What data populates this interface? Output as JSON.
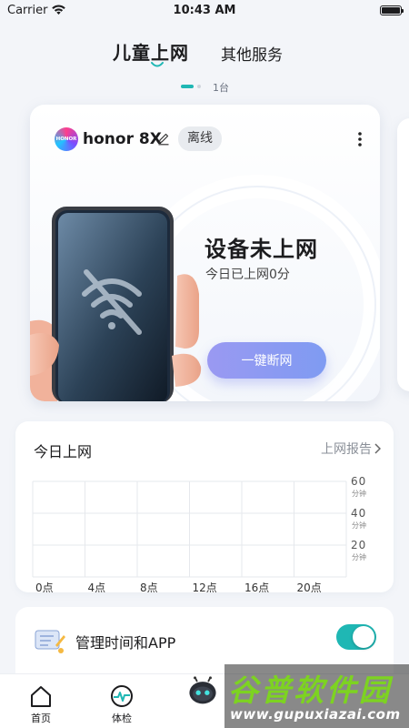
{
  "status_bar": {
    "carrier": "Carrier",
    "time": "10:43 AM"
  },
  "top_tabs": [
    {
      "label": "儿童上网",
      "active": true
    },
    {
      "label": "其他服务",
      "active": false
    }
  ],
  "pager": {
    "device_count": "1台"
  },
  "device_card": {
    "brand_logo_text": "HONOR",
    "device_name": "honor 8X",
    "status": "离线",
    "title": "设备未上网",
    "subtitle": "今日已上网0分",
    "disconnect_button": "一键断网",
    "icons": [
      "edit-icon",
      "more-icon",
      "wifi-off-icon"
    ]
  },
  "usage": {
    "title": "今日上网",
    "report_link": "上网报告",
    "chart_data": {
      "type": "bar",
      "categories": [
        "0点",
        "4点",
        "8点",
        "12点",
        "16点",
        "20点"
      ],
      "values": [],
      "y_ticks": [
        "60",
        "40",
        "20"
      ],
      "y_unit": "分钟",
      "ylim": [
        0,
        60
      ],
      "grid": true
    }
  },
  "manage": {
    "label": "管理时间和APP",
    "toggle_on": true
  },
  "bottom_nav": [
    {
      "label": "首页",
      "icon": "home-icon"
    },
    {
      "label": "体检",
      "icon": "checkup-icon"
    },
    {
      "label": "",
      "icon": "robot-icon"
    }
  ],
  "watermark": {
    "title": "谷普软件园",
    "url": "www.gupuxiazai.com"
  },
  "colors": {
    "accent": "#1fb7b4",
    "button_start": "#9a99f2",
    "button_end": "#7f9bf2",
    "watermark_green": "#7dd321"
  }
}
